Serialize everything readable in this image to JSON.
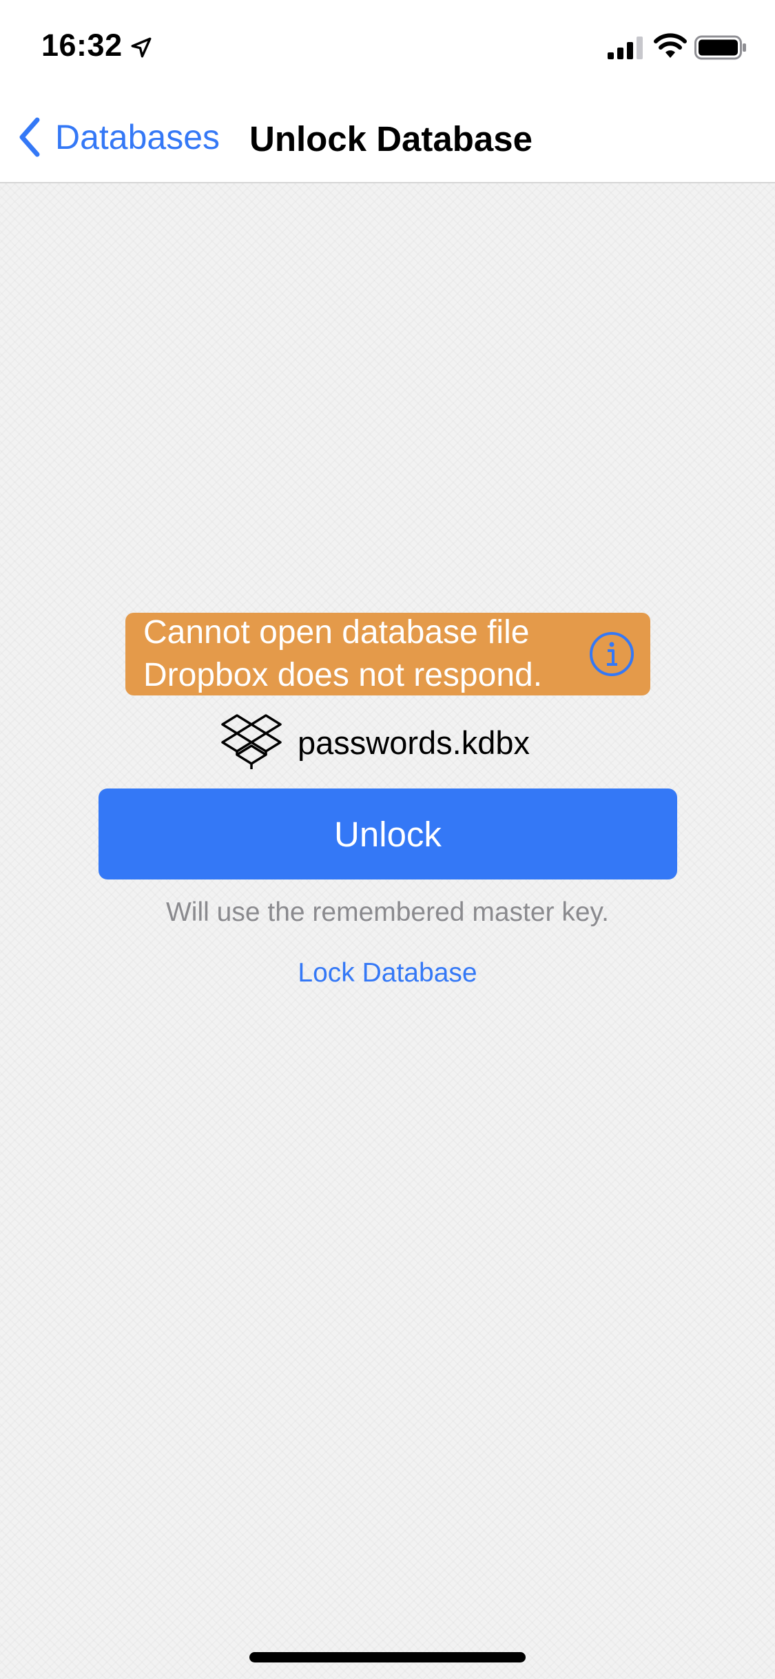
{
  "status_bar": {
    "time": "16:32",
    "icons": [
      "location-arrow-icon",
      "signal-icon",
      "wifi-icon",
      "battery-icon"
    ]
  },
  "nav": {
    "back_label": "Databases",
    "title": "Unlock Database"
  },
  "error": {
    "line1": "Cannot open database file",
    "line2": "Dropbox does not respond.",
    "icon": "info-icon"
  },
  "file": {
    "icon": "dropbox-icon",
    "name": "passwords.kdbx"
  },
  "unlock_button": {
    "label": "Unlock"
  },
  "hint": "Will use the remembered master key.",
  "lock_link": "Lock Database",
  "colors": {
    "accent": "#3478f6",
    "warning": "#e49a4a",
    "background": "#f2f2f2",
    "hint": "#8a8a8e"
  }
}
